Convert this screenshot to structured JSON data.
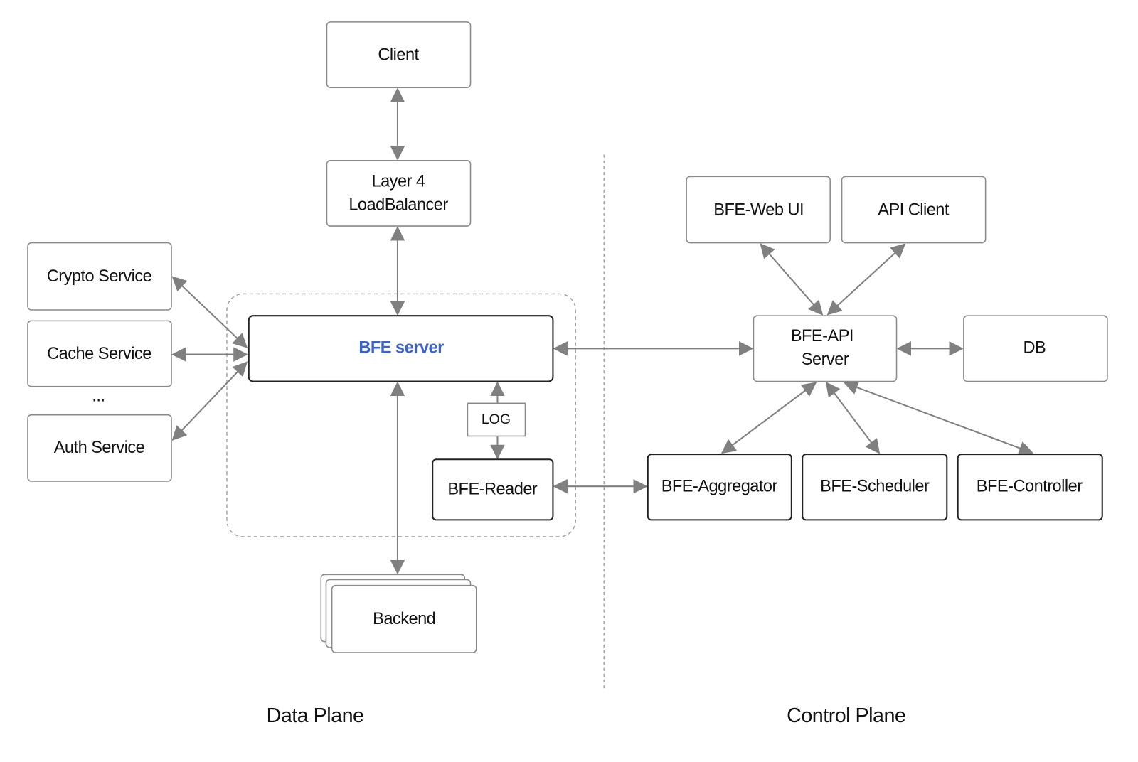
{
  "nodes": {
    "client": "Client",
    "lb_line1": "Layer 4",
    "lb_line2": "LoadBalancer",
    "crypto": "Crypto Service",
    "cache": "Cache Service",
    "ellipsis": "...",
    "auth": "Auth Service",
    "bfe_server": "BFE server",
    "log": "LOG",
    "bfe_reader": "BFE-Reader",
    "backend": "Backend",
    "web_ui": "BFE-Web UI",
    "api_client": "API Client",
    "api_server_line1": "BFE-API",
    "api_server_line2": "Server",
    "db": "DB",
    "aggregator": "BFE-Aggregator",
    "scheduler": "BFE-Scheduler",
    "controller": "BFE-Controller"
  },
  "planes": {
    "data": "Data Plane",
    "control": "Control Plane"
  },
  "colors": {
    "bfe_server_text": "#3b63c9",
    "arrow": "#808080"
  }
}
